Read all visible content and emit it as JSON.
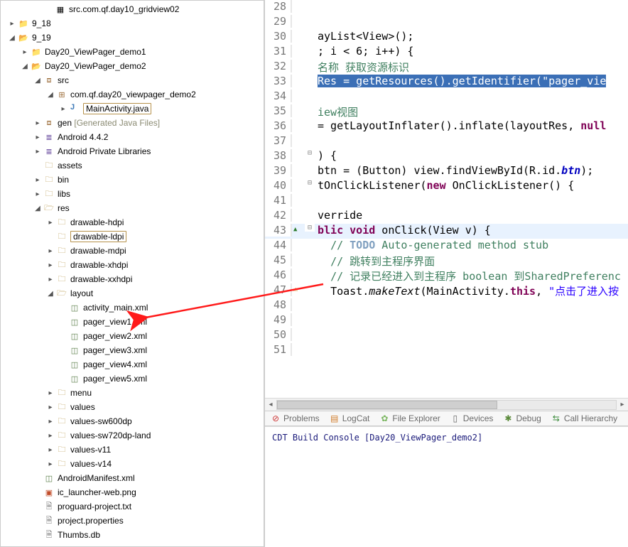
{
  "tree": {
    "top": "src.com.qf.day10_gridview02",
    "proj918": "9_18",
    "proj919": "9_19",
    "demo1": "Day20_ViewPager_demo1",
    "demo2": "Day20_ViewPager_demo2",
    "src": "src",
    "pkg": "com.qf.day20_viewpager_demo2",
    "main_activity": "MainActivity.java",
    "gen_label": "gen",
    "gen_note": "[Generated Java Files]",
    "android_442": "Android 4.4.2",
    "priv_libs": "Android Private Libraries",
    "assets": "assets",
    "bin": "bin",
    "libs": "libs",
    "res": "res",
    "d_hdpi": "drawable-hdpi",
    "d_ldpi": "drawable-ldpi",
    "d_mdpi": "drawable-mdpi",
    "d_xhdpi": "drawable-xhdpi",
    "d_xxhdpi": "drawable-xxhdpi",
    "layout": "layout",
    "activity_main": "activity_main.xml",
    "pv1": "pager_view1.xml",
    "pv2": "pager_view2.xml",
    "pv3": "pager_view3.xml",
    "pv4": "pager_view4.xml",
    "pv5": "pager_view5.xml",
    "menu": "menu",
    "values": "values",
    "values_sw600": "values-sw600dp",
    "values_sw720": "values-sw720dp-land",
    "values_v11": "values-v11",
    "values_v14": "values-v14",
    "manifest": "AndroidManifest.xml",
    "ic_launcher": "ic_launcher-web.png",
    "proguard": "proguard-project.txt",
    "projprops": "project.properties",
    "thumbs": "Thumbs.db"
  },
  "code": {
    "l28": "",
    "l29": "",
    "l30": "ayList<View>();",
    "l31_a": "; i < 6; i++) {",
    "l32": "名称 获取资源标识",
    "l33_sel": "Res = getResources().getIdentifier(\"pager_vie",
    "l34": "",
    "l35": "iew视图",
    "l36_a": " = getLayoutInflater().inflate(layoutRes, ",
    "l36_null": "null",
    "l37": "",
    "l38": ") {",
    "l39_a": " btn = (Button) view.findViewById(R.id.",
    "l39_btn": "btn",
    "l39_b": ");",
    "l40_a": "tOnClickListener(",
    "l40_new": "new",
    "l40_b": " OnClickListener() {",
    "l41": "",
    "l42": "verride",
    "l43_pub": "blic",
    "l43_void": " void",
    "l43_rest": " onClick(View v) {",
    "l44_a": "// ",
    "l44_todo": "TODO",
    "l44_b": " Auto-generated method stub",
    "l45": "// 跳转到主程序界面",
    "l46": "// 记录已经进入到主程序 boolean  到SharedPreferenc",
    "l47_a": "Toast.",
    "l47_mk": "makeText",
    "l47_b": "(MainActivity.",
    "l47_this": "this",
    "l47_c": ", ",
    "l47_str": "\"点击了进入按",
    "l48": "",
    "l49": "",
    "l50": "",
    "l51": ""
  },
  "lines": {
    "28": "28",
    "29": "29",
    "30": "30",
    "31": "31",
    "32": "32",
    "33": "33",
    "34": "34",
    "35": "35",
    "36": "36",
    "37": "37",
    "38": "38",
    "39": "39",
    "40": "40",
    "41": "41",
    "42": "42",
    "43": "43",
    "44": "44",
    "45": "45",
    "46": "46",
    "47": "47",
    "48": "48",
    "49": "49",
    "50": "50",
    "51": "51"
  },
  "tabs": {
    "problems": "Problems",
    "logcat": "LogCat",
    "file_explorer": "File Explorer",
    "devices": "Devices",
    "debug": "Debug",
    "call_hierarchy": "Call Hierarchy"
  },
  "console": "CDT Build Console [Day20_ViewPager_demo2]"
}
